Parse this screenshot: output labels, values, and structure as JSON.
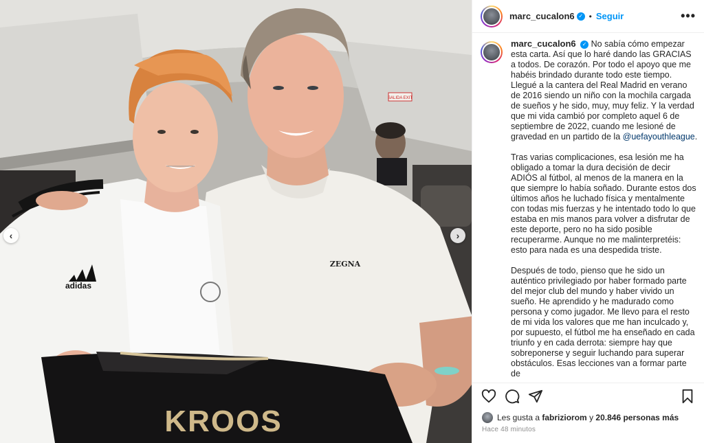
{
  "post": {
    "username": "marc_cucalon6",
    "follow_label": "Seguir",
    "more_label": "•••",
    "separator": "•"
  },
  "photo": {
    "jersey_name": "KROOS",
    "shirt_brand": "ZEGNA",
    "jacket_brand": "adidas",
    "sign_exit": "SALIDA EXIT",
    "nav_prev": "‹",
    "nav_next": "›"
  },
  "caption": {
    "username": "marc_cucalon6",
    "p1_before_mention": "No sabía cómo empezar esta carta. Así que lo haré dando las GRACIAS a todos. De corazón. Por todo el apoyo que me habéis brindado durante todo este tiempo. Llegué a la cantera del Real Madrid en verano de 2016 siendo un niño con la mochila cargada de sueños y he sido, muy, muy feliz. Y la verdad que mi vida cambió por completo aquel 6 de septiembre de 2022, cuando me lesioné de gravedad en un partido de la ",
    "mention": "@uefayouthleague",
    "p1_after_mention": ".",
    "p2": "Tras varias complicaciones, esa lesión me ha obligado a tomar la dura decisión de decir ADIÓS al fútbol, al menos de la manera en la que siempre lo había soñado. Durante estos dos últimos años he luchado física y mentalmente con todas mis fuerzas y he intentado todo lo que estaba en mis manos para volver a disfrutar de este deporte, pero no ha sido posible recuperarme. Aunque no me malinterpretéis: esto para nada es una despedida triste.",
    "p3": "Después de todo, pienso que he sido un auténtico privilegiado por haber formado parte del mejor club del mundo y haber vivido un sueño. He aprendido y he madurado como persona y como jugador. Me llevo para el resto de mi vida los valores que me han inculcado y, por supuesto, el fútbol me ha enseñado en cada triunfo y en cada derrota: siempre hay que sobreponerse y seguir luchando para superar obstáculos. Esas lecciones van a formar parte de"
  },
  "likes": {
    "prefix": "Les gusta a",
    "user": "fabriziorom",
    "connector": "y",
    "count": "20.846 personas más"
  },
  "timestamp": "Hace 48 minutos",
  "colors": {
    "accent": "#0095f6",
    "mention": "#00376b",
    "muted": "#8e8e8e"
  }
}
